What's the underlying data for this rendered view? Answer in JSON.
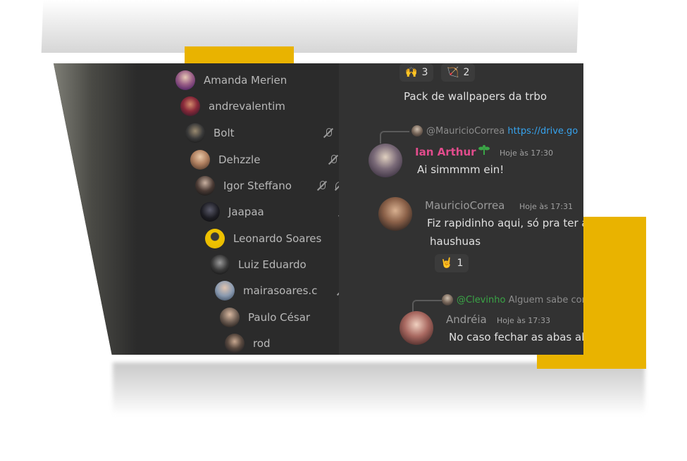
{
  "members": [
    {
      "name": "Amanda Merien",
      "muted": false,
      "deafened": false
    },
    {
      "name": "andrevalentim",
      "muted": false,
      "deafened": false
    },
    {
      "name": "Bolt",
      "muted": true,
      "deafened": false
    },
    {
      "name": "Dehzzle",
      "muted": true,
      "deafened": false
    },
    {
      "name": "Igor Steffano",
      "muted": true,
      "deafened": true
    },
    {
      "name": "Jaapaa",
      "muted": true,
      "deafened": false
    },
    {
      "name": "Leonardo Soares",
      "muted": false,
      "deafened": false
    },
    {
      "name": "Luiz Eduardo",
      "muted": false,
      "deafened": false
    },
    {
      "name": "mairasoares.c",
      "muted": true,
      "deafened": true
    },
    {
      "name": "Paulo César",
      "muted": true,
      "deafened": false
    },
    {
      "name": "rod",
      "muted": true,
      "deafened": false
    }
  ],
  "chat": {
    "reactions": [
      {
        "emoji": "raised-hands",
        "glyph": "🙌",
        "count": "3"
      },
      {
        "emoji": "crossed-bow",
        "glyph": "🏹",
        "count": "2"
      }
    ],
    "top_message": "Pack de wallpapers da trbo",
    "messages": [
      {
        "reply": {
          "author": "@MauricioCorrea",
          "text": "https://drive.go"
        },
        "author": "Ian Arthur",
        "author_color": "#e14c8c",
        "time": "Hoje às 17:30",
        "lines": [
          "Ai simmmm ein!"
        ]
      },
      {
        "author": "MauricioCorrea",
        "author_color": "#9a9a9a",
        "time": "Hoje às 17:31",
        "lines": [
          "Fiz rapidinho aqui, só pra ter algu",
          "haushuas"
        ],
        "reaction": {
          "emoji": "rock-on-hand",
          "glyph": "🤘",
          "count": "1"
        }
      },
      {
        "reply": {
          "author": "@Clevinho",
          "text": "Alguem sabe como é o"
        },
        "author": "Andréia",
        "author_color": "#9a9a9a",
        "time": "Hoje às 17:33",
        "lines": [
          "No caso fechar as abas abertas?"
        ]
      }
    ]
  },
  "colors": {
    "accent": "#e9b300",
    "link": "#36a3ee",
    "mention": "#3aa546",
    "panel": "#2b2b2b",
    "chat_bg": "#323232"
  }
}
